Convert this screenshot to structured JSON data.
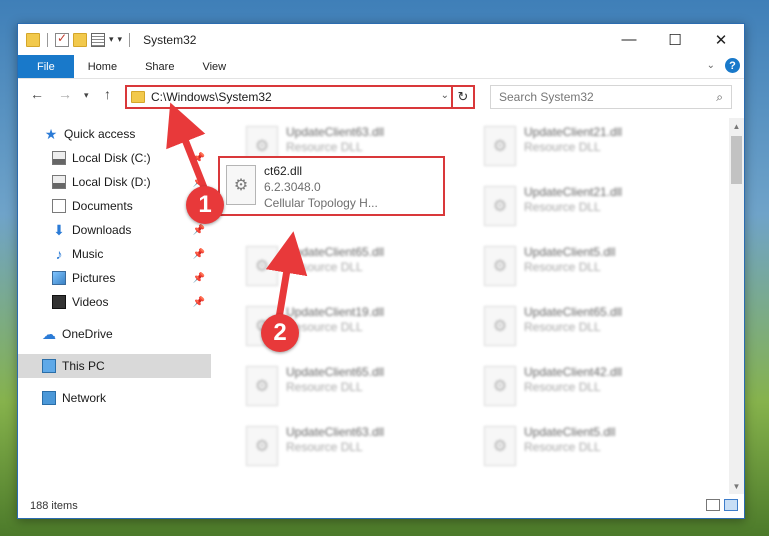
{
  "window": {
    "title": "System32",
    "controls": {
      "minimize": "—",
      "maximize": "☐",
      "close": "✕"
    }
  },
  "ribbon": {
    "tabs": [
      "File",
      "Home",
      "Share",
      "View"
    ],
    "help": "?"
  },
  "address": {
    "path": "C:\\Windows\\System32"
  },
  "search": {
    "placeholder": "Search System32"
  },
  "sidebar": {
    "items": [
      {
        "label": "Quick access",
        "icon": "star-icon"
      },
      {
        "label": "Local Disk (C:)",
        "icon": "drive-icon",
        "pinned": true
      },
      {
        "label": "Local Disk (D:)",
        "icon": "drive-icon",
        "pinned": true
      },
      {
        "label": "Documents",
        "icon": "documents-icon",
        "pinned": true
      },
      {
        "label": "Downloads",
        "icon": "downloads-icon",
        "pinned": true
      },
      {
        "label": "Music",
        "icon": "music-icon",
        "pinned": true
      },
      {
        "label": "Pictures",
        "icon": "pictures-icon",
        "pinned": true
      },
      {
        "label": "Videos",
        "icon": "videos-icon",
        "pinned": true
      },
      {
        "label": "OneDrive",
        "icon": "onedrive-icon"
      },
      {
        "label": "This PC",
        "icon": "this-pc-icon",
        "selected": true
      },
      {
        "label": "Network",
        "icon": "network-icon"
      }
    ]
  },
  "files": {
    "focused": {
      "name": "ct62.dll",
      "version": "6.2.3048.0",
      "description": "Cellular Topology H..."
    },
    "blurred_left": [
      {
        "name": "UpdateClient63.dll",
        "type": "Resource DLL"
      },
      {
        "name": "UpdateClient65.dll",
        "type": "Resource DLL"
      },
      {
        "name": "UpdateClient19.dll",
        "type": "Resource DLL"
      },
      {
        "name": "UpdateClient65.dll",
        "type": "Resource DLL"
      },
      {
        "name": "UpdateClient63.dll",
        "type": "Resource DLL"
      }
    ],
    "blurred_right": [
      {
        "name": "UpdateClient21.dll",
        "type": "Resource DLL"
      },
      {
        "name": "UpdateClient21.dll",
        "type": "Resource DLL"
      },
      {
        "name": "UpdateClient5.dll",
        "type": "Resource DLL"
      },
      {
        "name": "UpdateClient65.dll",
        "type": "Resource DLL"
      },
      {
        "name": "UpdateClient42.dll",
        "type": "Resource DLL"
      },
      {
        "name": "UpdateClient5.dll",
        "type": "Resource DLL"
      }
    ]
  },
  "status": {
    "count": "188 items"
  },
  "annotations": {
    "step1": "1",
    "step2": "2",
    "color": "#e8393a"
  }
}
